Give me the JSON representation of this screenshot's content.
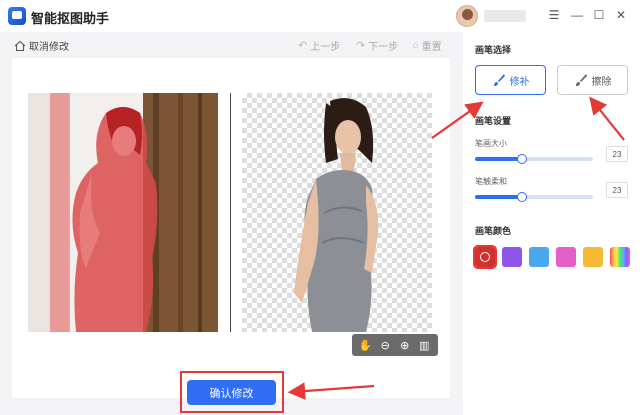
{
  "app": {
    "title": "智能抠图助手"
  },
  "window_controls": {
    "menu": "☰",
    "minimize": "—",
    "maximize": "☐",
    "close": "✕"
  },
  "toolbar": {
    "cancel_label": "取消修改",
    "undo_label": "上一步",
    "redo_label": "下一步",
    "reset_label": "重置"
  },
  "footer": {
    "confirm_label": "确认修改"
  },
  "panel": {
    "brush_select_title": "画笔选择",
    "repair_label": "修补",
    "erase_label": "擦除",
    "brush_settings_title": "画笔设置",
    "size_label": "笔画大小",
    "size_value": "23",
    "size_level": 0.4,
    "soft_label": "笔触柔和",
    "soft_value": "23",
    "soft_level": 0.4,
    "color_title": "画笔颜色",
    "colors": [
      "#d32f2f",
      "#8e55ea",
      "#4aa8f0",
      "#e45fc8",
      "#f5b935",
      "rainbow"
    ],
    "selected_color_index": 0
  },
  "colors": {
    "accent": "#2f6df2",
    "highlight": "#e53935"
  }
}
